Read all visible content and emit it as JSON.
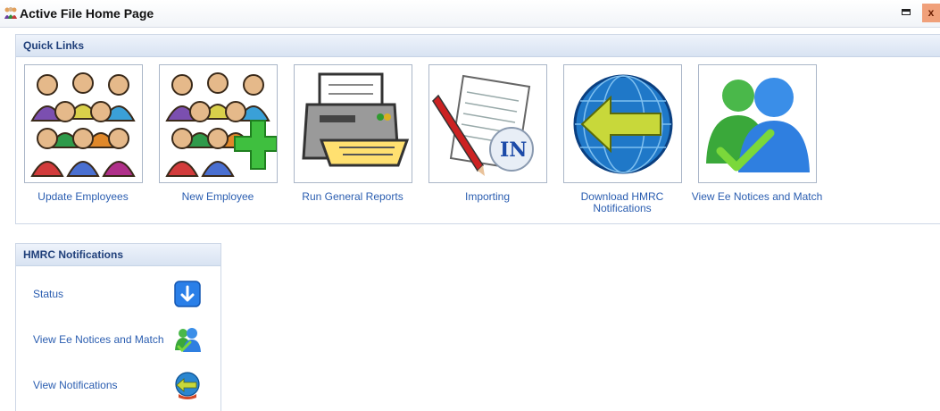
{
  "window": {
    "title": "Active File Home Page",
    "app_icon": "people-icon",
    "controls": {
      "restore_icon": "restore-icon",
      "close_label": "x"
    }
  },
  "quick_links": {
    "title": "Quick Links",
    "items": [
      {
        "label": "Update Employees",
        "icon": "employees-group-icon"
      },
      {
        "label": "New Employee",
        "icon": "add-employee-icon"
      },
      {
        "label": "Run General Reports",
        "icon": "printer-icon"
      },
      {
        "label": "Importing",
        "icon": "import-document-icon"
      },
      {
        "label": "Download HMRC Notifications",
        "icon": "globe-download-icon"
      },
      {
        "label": "View Ee Notices and Match",
        "icon": "users-check-icon"
      }
    ]
  },
  "hmrc_notifications": {
    "title": "HMRC Notifications",
    "items": [
      {
        "label": "Status",
        "icon": "down-arrow-icon"
      },
      {
        "label": "View Ee Notices and Match",
        "icon": "users-check-icon"
      },
      {
        "label": "View Notifications",
        "icon": "globe-icon"
      }
    ]
  },
  "colors": {
    "link": "#2a5db0",
    "header_text": "#1f3f7a",
    "border": "#cdd7e6"
  }
}
